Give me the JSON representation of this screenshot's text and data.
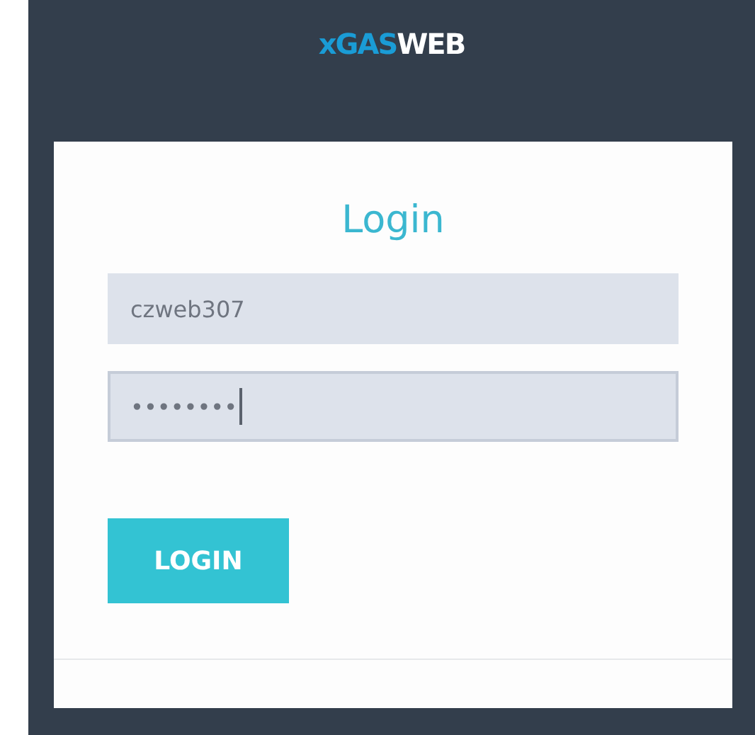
{
  "logo": {
    "parts": [
      {
        "text": "xGAS",
        "color": "#1a9cd6"
      },
      {
        "text": "WEB",
        "color": "#ffffff"
      }
    ]
  },
  "login_form": {
    "title": "Login",
    "username": {
      "value": "czweb307",
      "focused": false
    },
    "password": {
      "value": "••••••••",
      "focused": true
    },
    "button": "LOGIN"
  }
}
